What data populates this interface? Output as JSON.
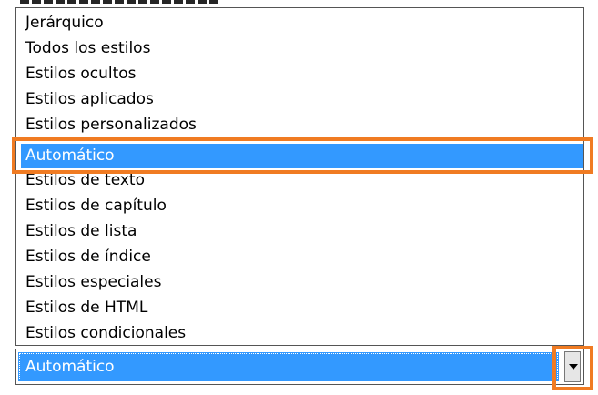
{
  "list": {
    "items": [
      {
        "label": "Jerárquico"
      },
      {
        "label": "Todos los estilos"
      },
      {
        "label": "Estilos ocultos"
      },
      {
        "label": "Estilos aplicados"
      },
      {
        "label": "Estilos personalizados"
      },
      {
        "label": "Automático"
      },
      {
        "label": "Estilos de texto"
      },
      {
        "label": "Estilos de capítulo"
      },
      {
        "label": "Estilos de lista"
      },
      {
        "label": "Estilos de índice"
      },
      {
        "label": "Estilos especiales"
      },
      {
        "label": "Estilos de HTML"
      },
      {
        "label": "Estilos condicionales"
      }
    ],
    "selected_label": "Automático"
  },
  "combo": {
    "value": "Automático",
    "button_icon": "chevron-down-icon"
  },
  "colors": {
    "selection": "#3399ff",
    "highlight_outline": "#f07b22"
  }
}
